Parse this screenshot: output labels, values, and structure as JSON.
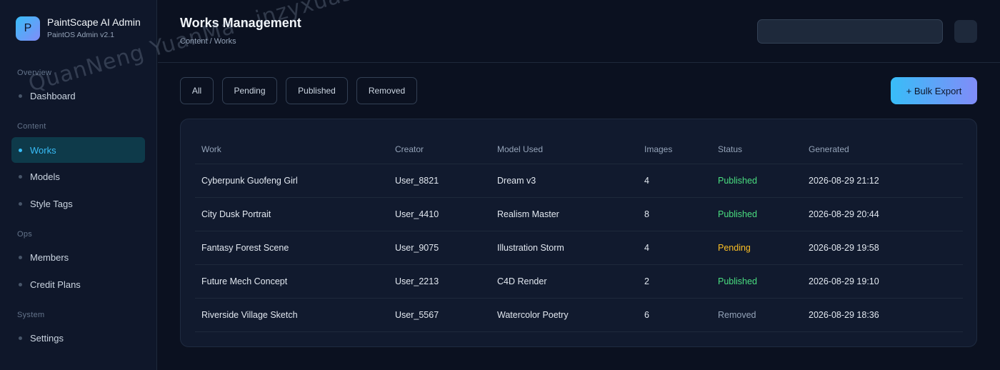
{
  "brand": {
    "logo_letter": "P",
    "title": "PaintScape AI Admin",
    "subtitle": "PaintOS Admin v2.1"
  },
  "sidebar": {
    "sections": [
      {
        "label": "Overview",
        "items": [
          {
            "label": "Dashboard"
          }
        ]
      },
      {
        "label": "Content",
        "items": [
          {
            "label": "Works",
            "active": true
          },
          {
            "label": "Models"
          },
          {
            "label": "Style Tags"
          }
        ]
      },
      {
        "label": "Ops",
        "items": [
          {
            "label": "Members"
          },
          {
            "label": "Credit Plans"
          }
        ]
      },
      {
        "label": "System",
        "items": [
          {
            "label": "Settings"
          }
        ]
      }
    ]
  },
  "header": {
    "title": "Works Management",
    "breadcrumb": "Content / Works",
    "search_value": ""
  },
  "filters": [
    "All",
    "Pending",
    "Published",
    "Removed"
  ],
  "toolbar": {
    "export_label": "+ Bulk Export"
  },
  "table": {
    "columns": [
      "Work",
      "Creator",
      "Model Used",
      "Images",
      "Status",
      "Generated"
    ],
    "rows": [
      [
        "Cyberpunk Guofeng Girl",
        "User_8821",
        "Dream v3",
        "4",
        "Published",
        "2026-08-29 21:12"
      ],
      [
        "City Dusk Portrait",
        "User_4410",
        "Realism Master",
        "8",
        "Published",
        "2026-08-29 20:44"
      ],
      [
        "Fantasy Forest Scene",
        "User_9075",
        "Illustration Storm",
        "4",
        "Pending",
        "2026-08-29 19:58"
      ],
      [
        "Future Mech Concept",
        "User_2213",
        "C4D Render",
        "2",
        "Published",
        "2026-08-29 19:10"
      ],
      [
        "Riverside Village Sketch",
        "User_5567",
        "Watercolor Poetry",
        "6",
        "Removed",
        "2026-08-29 18:36"
      ]
    ]
  },
  "watermark": "QuanNeng YuanMa · inzyxuashop.com",
  "colors": {
    "accent": "#38bdf8",
    "accent_alt": "#818cf8",
    "published": "#4ade80",
    "pending": "#fbbf24",
    "removed": "#94a3b8"
  }
}
